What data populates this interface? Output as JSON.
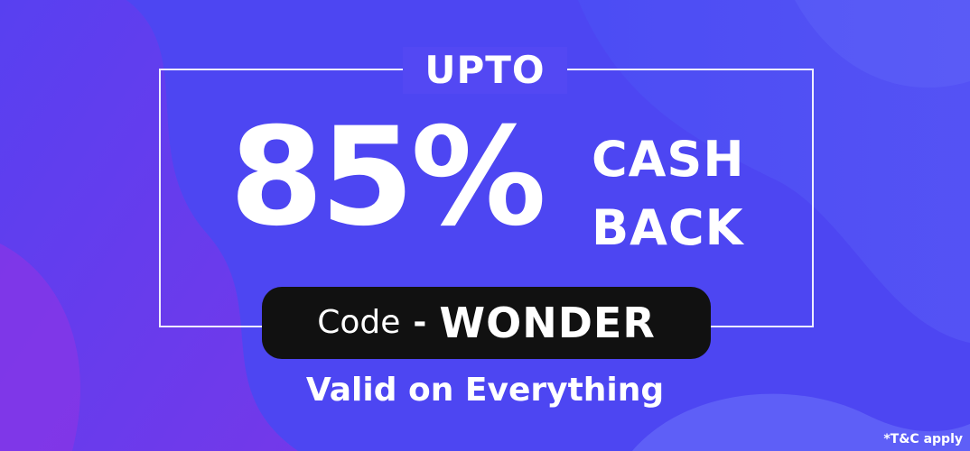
{
  "banner": {
    "upto": "UPTO",
    "percent": "85%",
    "cash": "CASH",
    "back": "BACK",
    "code_label": "Code",
    "code_separator": "-",
    "code_value": "WONDER",
    "valid_text": "Valid on Everything",
    "tnc": "*T&C apply"
  },
  "colors": {
    "background": "#4d46f2",
    "pill": "#111111",
    "text": "#ffffff"
  }
}
